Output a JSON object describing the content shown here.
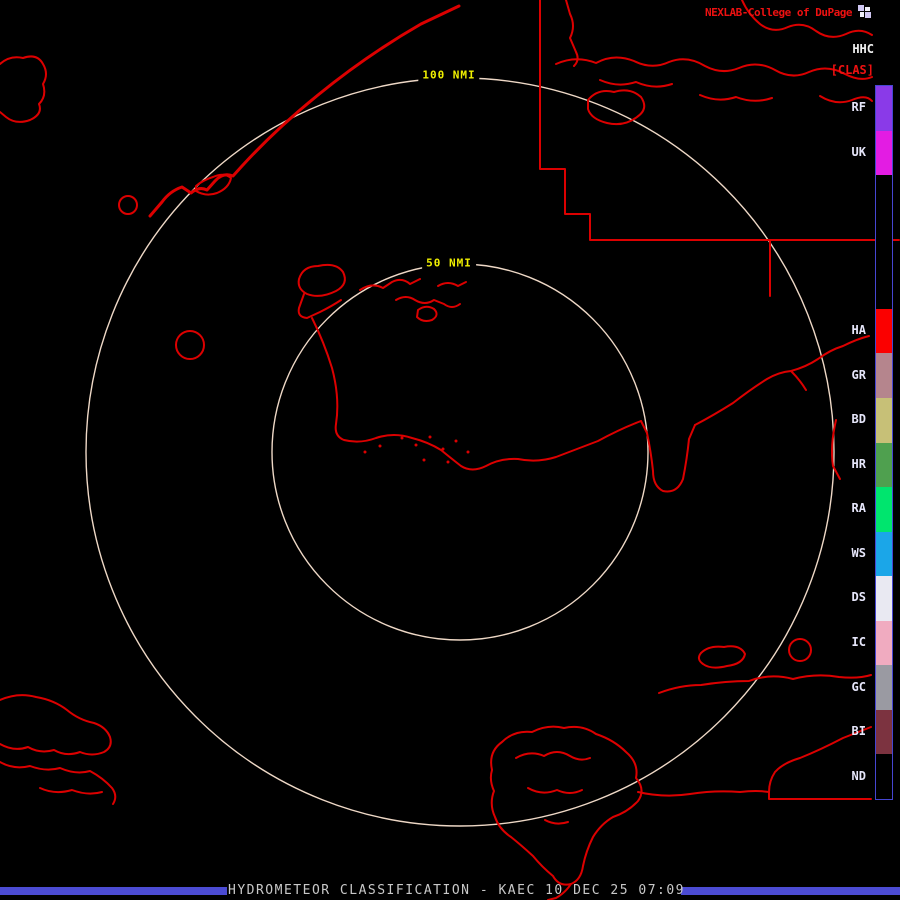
{
  "colors": {
    "background": "#000000",
    "map_outline": "#dc0000",
    "range_ring": "#eed8c6",
    "ring_label": "#f0f000",
    "brand_text": "#ee1111",
    "product_text": "#f0f0f0",
    "clas_text": "#ee1111",
    "legend_label": "#e6e6fa",
    "legend_border": "#4646d2",
    "footer_text": "#c8c8c8",
    "footer_bar": "#4b4bd2"
  },
  "header": {
    "brand": "NEXLAB-College of DuPage",
    "logo_icon": "cod-logo",
    "product_code": "HHC",
    "classification": "[CLAS]"
  },
  "rings": {
    "inner_label": "50 NMI",
    "outer_label": "100 NMI"
  },
  "legend": {
    "segments": [
      {
        "label": "RF",
        "color": "#8a3ae8"
      },
      {
        "label": "UK",
        "color": "#e31ce3"
      },
      {
        "label": "",
        "color": "#000000"
      },
      {
        "label": "",
        "color": "#000000"
      },
      {
        "label": "",
        "color": "#000000"
      },
      {
        "label": "HA",
        "color": "#fb0000"
      },
      {
        "label": "GR",
        "color": "#b5858d"
      },
      {
        "label": "BD",
        "color": "#c7c077"
      },
      {
        "label": "HR",
        "color": "#4fa04f"
      },
      {
        "label": "RA",
        "color": "#00e56e"
      },
      {
        "label": "WS",
        "color": "#1ba6e8"
      },
      {
        "label": "DS",
        "color": "#e9e9f2"
      },
      {
        "label": "IC",
        "color": "#f0abc0"
      },
      {
        "label": "GC",
        "color": "#9a9aa2"
      },
      {
        "label": "BI",
        "color": "#7c3340"
      },
      {
        "label": "ND",
        "color": "#000000"
      }
    ]
  },
  "footer": {
    "title": "HYDROMETEOR CLASSIFICATION - KAEC 10 DEC 25 07:09"
  }
}
